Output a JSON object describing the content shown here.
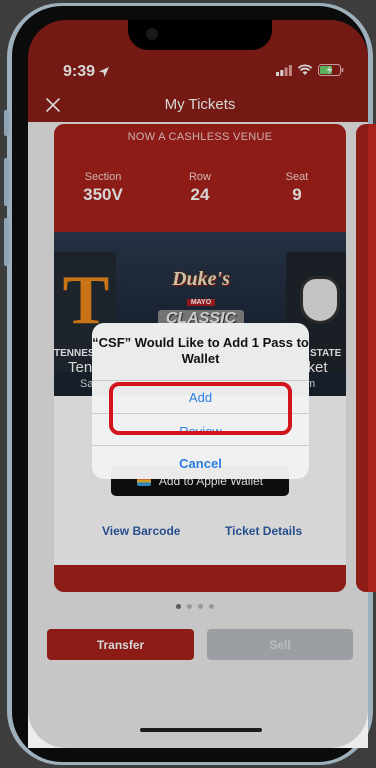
{
  "status_bar": {
    "time": "9:39"
  },
  "nav": {
    "title": "My Tickets"
  },
  "ticket": {
    "venue_note": "NOW A CASHLESS VENUE",
    "section_label": "Section",
    "section_value": "350V",
    "row_label": "Row",
    "row_value": "24",
    "seat_label": "Seat",
    "seat_value": "9",
    "banner": {
      "logo_top": "Duke's",
      "logo_mid": "MAYO",
      "logo_bottom": "CLASSIC",
      "left_team_letter": "T",
      "left_team_partial": "TENNES",
      "right_team_partial": "STATE",
      "left_partial_text": "Ten",
      "left_partial_sub": "Sa",
      "right_partial_text": "cket",
      "right_partial_sub": "m"
    },
    "wallet_button": "Add to Apple Wallet",
    "view_barcode": "View Barcode",
    "ticket_details": "Ticket Details"
  },
  "pager": {
    "count": 4,
    "active": 0
  },
  "actions": {
    "transfer": "Transfer",
    "sell": "Sell"
  },
  "alert": {
    "title": "“CSF” Would Like to Add 1 Pass to Wallet",
    "add": "Add",
    "review": "Review",
    "cancel": "Cancel"
  },
  "colors": {
    "brand_red": "#a8211b",
    "link_blue": "#2f5ea8",
    "alert_blue": "#2a7de1",
    "highlight_red": "#d2141c"
  }
}
